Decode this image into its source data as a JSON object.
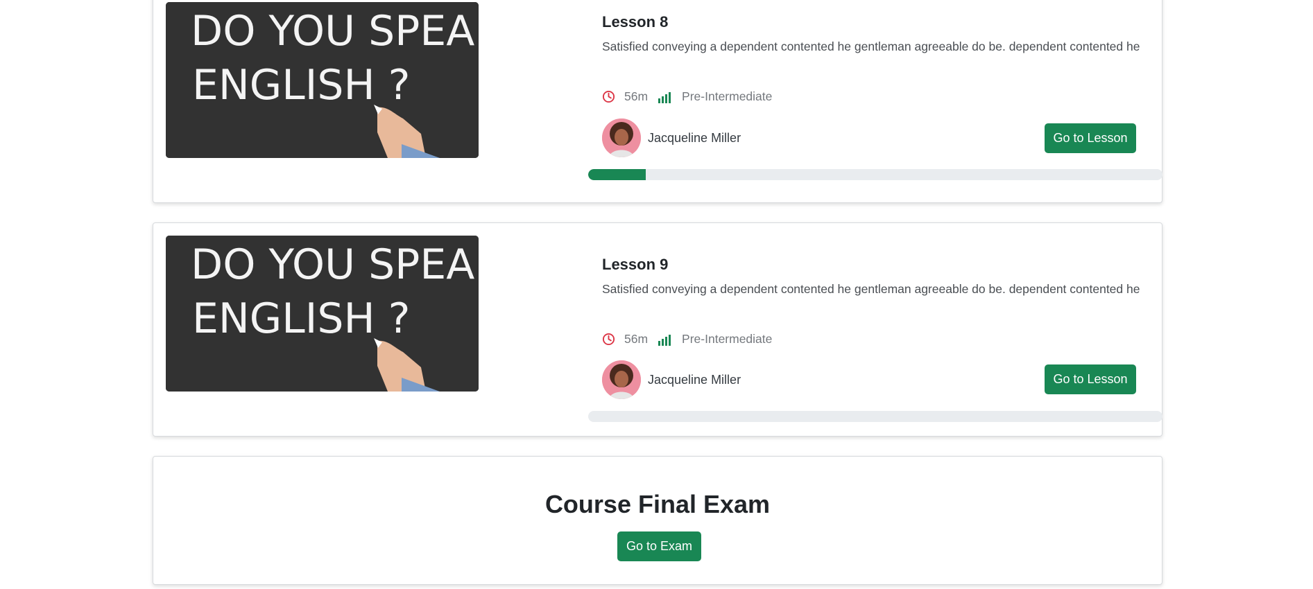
{
  "lessons": [
    {
      "title": "Lesson 8",
      "description": "Satisfied conveying a dependent contented he gentleman agreeable do be. dependent contented he",
      "duration": "56m",
      "level": "Pre-Intermediate",
      "author": "Jacqueline Miller",
      "button_label": "Go to Lesson",
      "progress_percent": 10,
      "thumbnail_text": [
        "DO YOU SPEAK",
        "ENGLISH ?"
      ]
    },
    {
      "title": "Lesson 9",
      "description": "Satisfied conveying a dependent contented he gentleman agreeable do be. dependent contented he",
      "duration": "56m",
      "level": "Pre-Intermediate",
      "author": "Jacqueline Miller",
      "button_label": "Go to Lesson",
      "progress_percent": 0,
      "thumbnail_text": [
        "DO YOU SPEAK",
        "ENGLISH ?"
      ]
    }
  ],
  "exam": {
    "title": "Course Final Exam",
    "button_label": "Go to Exam"
  },
  "colors": {
    "accent": "#198754",
    "clock_icon": "#dc3545",
    "progress_track": "#e9ecef"
  },
  "icons": {
    "duration": "clock-icon",
    "level": "signal-bars-icon"
  }
}
